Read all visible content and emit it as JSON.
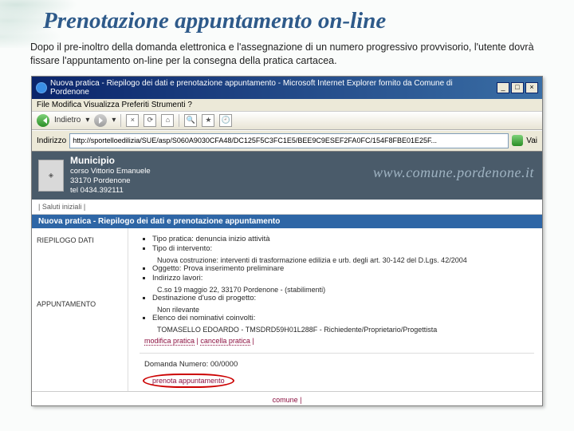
{
  "slide": {
    "title": "Prenotazione appuntamento on-line",
    "intro": "Dopo il pre-inoltro della domanda elettronica e l'assegnazione di un numero progressivo provvisorio,  l'utente dovrà fissare l'appuntamento on-line per la consegna della pratica cartacea."
  },
  "browser": {
    "title": "Nuova pratica - Riepilogo dei dati e prenotazione appuntamento - Microsoft Internet Explorer fornito da Comune di Pordenone",
    "menubar": "File   Modifica   Visualizza   Preferiti   Strumenti   ?",
    "back_label": "Indietro",
    "addr_label": "Indirizzo",
    "url": "http://sportelloedilizia/SUE/asp/S060A9030CFA48/DC125F5C3FC1E5/BEE9C9ESEF2FA0FC/154F8FBE01E25F...",
    "go_label": "Vai"
  },
  "banner": {
    "municipio": "Municipio",
    "line1": "corso Vittorio Emanuele",
    "line2": "33170 Pordenone",
    "line3": "tel 0434.392111",
    "domain": "www.comune.pordenone.it"
  },
  "subnav": "| Saluti iniziali |",
  "bluebar": "Nuova pratica - Riepilogo dei dati e prenotazione appuntamento",
  "left": {
    "riepilogo": "RIEPILOGO DATI",
    "appuntamento": "APPUNTAMENTO"
  },
  "riepilogo": {
    "i0": "Tipo pratica: denuncia inizio attività",
    "i1": "Tipo di intervento:",
    "i1b": "Nuova costruzione: interventi di trasformazione edilizia e urb. degli art. 30-142 del D.Lgs. 42/2004",
    "i2": "Oggetto: Prova inserimento preliminare",
    "i3": "Indirizzo lavori:",
    "i3b": "C.so 19 maggio 22, 33170 Pordenone - (stabilimenti)",
    "i4": "Destinazione d'uso di progetto:",
    "i4b": "Non rilevante",
    "i5": "Elenco dei nominativi coinvolti:",
    "i5b": "TOMASELLO EDOARDO - TMSDRD59H01L288F - Richiedente/Proprietario/Progettista",
    "link_modifica": "modifica pratica",
    "link_cancella": "cancella pratica"
  },
  "apt": {
    "domanda": "Domanda Numero: 00/0000",
    "prenota": "prenota appuntamento"
  },
  "footer": "comune |"
}
